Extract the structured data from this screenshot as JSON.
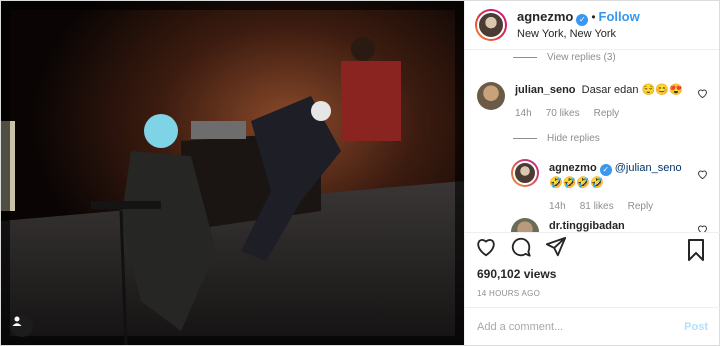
{
  "post": {
    "username": "agnezmo",
    "follow_label": "Follow",
    "location": "New York, New York",
    "separator": "•"
  },
  "comments": {
    "view_replies": "View replies (3)",
    "hide_replies": "Hide replies",
    "items": [
      {
        "user": "julian_seno",
        "text": "Dasar edan 😌😊😍",
        "time": "14h",
        "likes": "70 likes",
        "reply": "Reply"
      },
      {
        "user": "agnezmo",
        "mention": "@julian_seno",
        "text": "🤣🤣🤣🤣",
        "time": "14h",
        "likes": "81 likes",
        "reply": "Reply"
      },
      {
        "user": "dr.tinggibadan"
      }
    ]
  },
  "stats": {
    "views": "690,102 views",
    "time_ago": "14 HOURS AGO"
  },
  "composer": {
    "placeholder": "Add a comment...",
    "post_label": "Post"
  },
  "icons": [
    "heart-icon",
    "comment-icon",
    "share-icon",
    "bookmark-icon",
    "verified-icon",
    "tag-user-icon"
  ],
  "colors": {
    "link": "#3897f0",
    "muted": "#8e8e8e",
    "border": "#dbdbdb"
  }
}
